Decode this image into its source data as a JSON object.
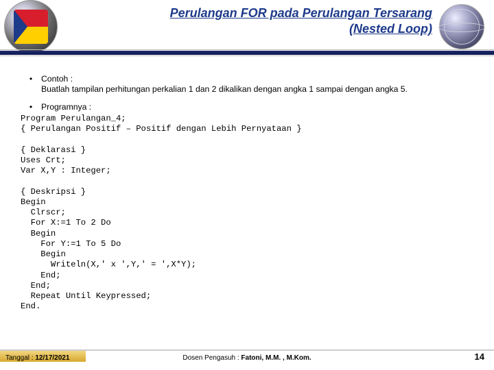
{
  "header": {
    "title_line1": "Perulangan FOR pada Perulangan Tersarang",
    "title_line2": "(Nested Loop)"
  },
  "body": {
    "bullet1_label": "Contoh :",
    "bullet1_text": "Buatlah tampilan perhitungan perkalian 1 dan 2 dikalikan dengan angka 1 sampai dengan angka 5.",
    "bullet2_label": "Programnya :",
    "code": "Program Perulangan_4;\n{ Perulangan Positif – Positif dengan Lebih Pernyataan }\n\n{ Deklarasi }\nUses Crt;\nVar X,Y : Integer;\n\n{ Deskripsi }\nBegin\n  Clrscr;\n  For X:=1 To 2 Do\n  Begin\n    For Y:=1 To 5 Do\n    Begin\n      Writeln(X,' x ',Y,' = ',X*Y);\n    End;\n  End;\n  Repeat Until Keypressed;\nEnd."
  },
  "footer": {
    "date_label": "Tanggal : ",
    "date_value": "12/17/2021",
    "lecturer_label": "Dosen Pengasuh : ",
    "lecturer_value": "Fatoni, M.M. , M.Kom.",
    "page": "14"
  }
}
